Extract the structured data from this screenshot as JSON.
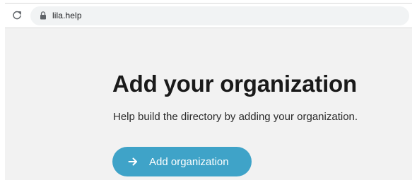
{
  "browser": {
    "url": "lila.help",
    "reload_icon": "reload-icon",
    "secure_icon": "lock-icon"
  },
  "main": {
    "title": "Add your organization",
    "description": "Help build the directory by adding your organization.",
    "cta": {
      "label": "Add organization",
      "icon": "arrow-right-icon",
      "color": "#3fa3c8"
    }
  },
  "colors": {
    "page_background": "#f2f2f2",
    "button_accent": "#3fa3c8"
  }
}
